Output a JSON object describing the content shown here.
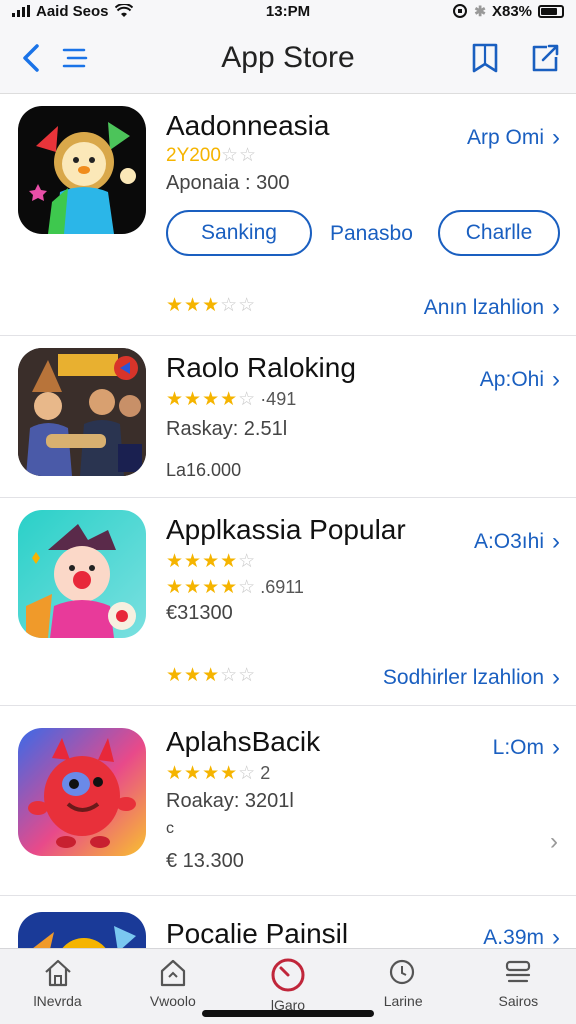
{
  "status_bar": {
    "carrier": "Aaid Seos",
    "time": "13:PM",
    "battery": "X83%"
  },
  "nav": {
    "title": "App Store"
  },
  "apps": [
    {
      "name": "Aadonneasia",
      "price": "Arp Omi",
      "rating_text": "2Y200",
      "meta": "Aponaia : 300",
      "buttons": [
        "Sanking",
        "Panasbo",
        "Charlle"
      ],
      "bottom_rating": 3,
      "bottom_link": "Anın lzahlion"
    },
    {
      "name": "Raolo Raloking",
      "price": "Ap:Ohi",
      "rating": 4,
      "rating_text": "·491",
      "meta": "Raskay: 2.51l",
      "meta2": "La16.000"
    },
    {
      "name": "Applkassia Popular",
      "price": "A:O3ıhi",
      "rating": 4,
      "rating2": 4,
      "rating2_text": ".6911",
      "meta": "€31300",
      "bottom_rating": 3,
      "bottom_link": "Sodhirler lzahlion"
    },
    {
      "name": "AplahsBacik",
      "price": "L:Om",
      "rating": 4,
      "rating_text": "2",
      "meta": "Roakay: 3201l",
      "meta2": "c",
      "meta3": "€ 13.300"
    },
    {
      "name": "Pocalie Painsil",
      "price": "A.39m"
    }
  ],
  "tabs": [
    {
      "label": "lNevrda",
      "icon": "home-icon"
    },
    {
      "label": "Vwoolo",
      "icon": "store-icon"
    },
    {
      "label": "lGaro",
      "icon": "clock-icon"
    },
    {
      "label": "Larine",
      "icon": "search-icon"
    },
    {
      "label": "Sairos",
      "icon": "stack-icon"
    }
  ],
  "colors": {
    "accent": "#1a5fc0",
    "star": "#f5b400",
    "tab_active": "#c0263a"
  }
}
